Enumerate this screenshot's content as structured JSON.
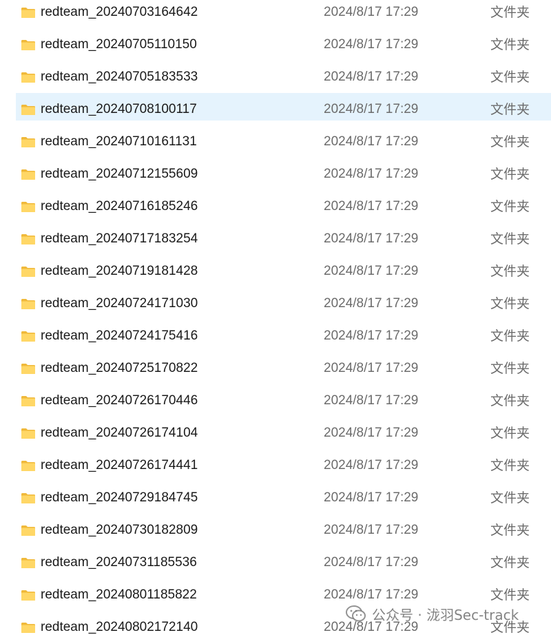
{
  "file_list": {
    "selected_index": 3,
    "rows": [
      {
        "name": "redteam_20240703164642",
        "date": "2024/8/17 17:29",
        "type": "文件夹"
      },
      {
        "name": "redteam_20240705110150",
        "date": "2024/8/17 17:29",
        "type": "文件夹"
      },
      {
        "name": "redteam_20240705183533",
        "date": "2024/8/17 17:29",
        "type": "文件夹"
      },
      {
        "name": "redteam_20240708100117",
        "date": "2024/8/17 17:29",
        "type": "文件夹"
      },
      {
        "name": "redteam_20240710161131",
        "date": "2024/8/17 17:29",
        "type": "文件夹"
      },
      {
        "name": "redteam_20240712155609",
        "date": "2024/8/17 17:29",
        "type": "文件夹"
      },
      {
        "name": "redteam_20240716185246",
        "date": "2024/8/17 17:29",
        "type": "文件夹"
      },
      {
        "name": "redteam_20240717183254",
        "date": "2024/8/17 17:29",
        "type": "文件夹"
      },
      {
        "name": "redteam_20240719181428",
        "date": "2024/8/17 17:29",
        "type": "文件夹"
      },
      {
        "name": "redteam_20240724171030",
        "date": "2024/8/17 17:29",
        "type": "文件夹"
      },
      {
        "name": "redteam_20240724175416",
        "date": "2024/8/17 17:29",
        "type": "文件夹"
      },
      {
        "name": "redteam_20240725170822",
        "date": "2024/8/17 17:29",
        "type": "文件夹"
      },
      {
        "name": "redteam_20240726170446",
        "date": "2024/8/17 17:29",
        "type": "文件夹"
      },
      {
        "name": "redteam_20240726174104",
        "date": "2024/8/17 17:29",
        "type": "文件夹"
      },
      {
        "name": "redteam_20240726174441",
        "date": "2024/8/17 17:29",
        "type": "文件夹"
      },
      {
        "name": "redteam_20240729184745",
        "date": "2024/8/17 17:29",
        "type": "文件夹"
      },
      {
        "name": "redteam_20240730182809",
        "date": "2024/8/17 17:29",
        "type": "文件夹"
      },
      {
        "name": "redteam_20240731185536",
        "date": "2024/8/17 17:29",
        "type": "文件夹"
      },
      {
        "name": "redteam_20240801185822",
        "date": "2024/8/17 17:29",
        "type": "文件夹"
      },
      {
        "name": "redteam_20240802172140",
        "date": "2024/8/17 17:29",
        "type": "文件夹"
      }
    ]
  },
  "watermark": {
    "text": "公众号 · 泷羽Sec-track",
    "icon": "wechat-icon"
  },
  "colors": {
    "folder_fill": "#ffd766",
    "folder_tab": "#f0b93a",
    "selected_row_bg": "#e5f3fd"
  }
}
